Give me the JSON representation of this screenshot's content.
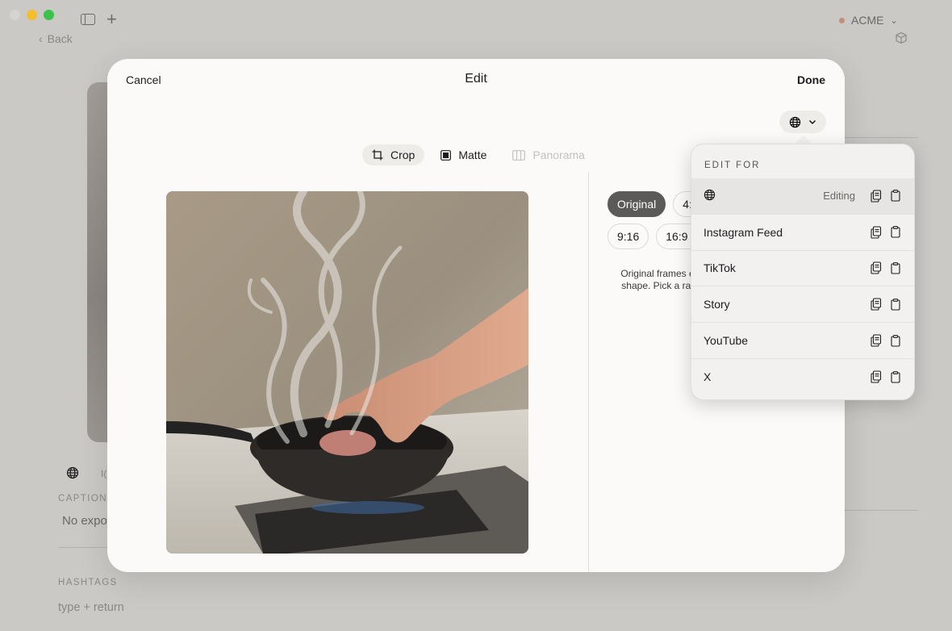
{
  "window": {
    "back_label": "Back",
    "workspace_name": "ACME",
    "workspace_dot_color": "#c2907a"
  },
  "background": {
    "platform_label_fragment": "I(",
    "caption_label": "CAPTION",
    "caption_value": "No expo",
    "hashtags_label": "HASHTAGS",
    "hashtags_placeholder": "type + return"
  },
  "modal": {
    "cancel_label": "Cancel",
    "title": "Edit",
    "done_label": "Done",
    "platform_icon": "globe-icon",
    "tools": [
      {
        "label": "Crop",
        "icon": "crop-icon",
        "active": true,
        "enabled": true
      },
      {
        "label": "Matte",
        "icon": "matte-icon",
        "active": false,
        "enabled": true
      },
      {
        "label": "Panorama",
        "icon": "panorama-icon",
        "active": false,
        "enabled": false
      }
    ],
    "ratios_row1": [
      "Original",
      "4:"
    ],
    "ratios_row2": [
      "9:16",
      "16:9"
    ],
    "selected_ratio": "Original",
    "ratio_hint_line1": "Original frames e",
    "ratio_hint_line2": "shape. Pick a rat"
  },
  "popover": {
    "heading": "EDIT FOR",
    "items": [
      {
        "label": "",
        "icon": "globe-icon",
        "status": "Editing",
        "current": true
      },
      {
        "label": "Instagram Feed",
        "status": "",
        "current": false
      },
      {
        "label": "TikTok",
        "status": "",
        "current": false
      },
      {
        "label": "Story",
        "status": "",
        "current": false
      },
      {
        "label": "YouTube",
        "status": "",
        "current": false
      },
      {
        "label": "X",
        "status": "",
        "current": false
      }
    ]
  },
  "colors": {
    "accent_dark": "#5b5a58",
    "modal_bg": "#fbfaf8",
    "traffic_close": "#d6d4d1",
    "traffic_min": "#f5be2c",
    "traffic_max": "#3cc24b"
  }
}
